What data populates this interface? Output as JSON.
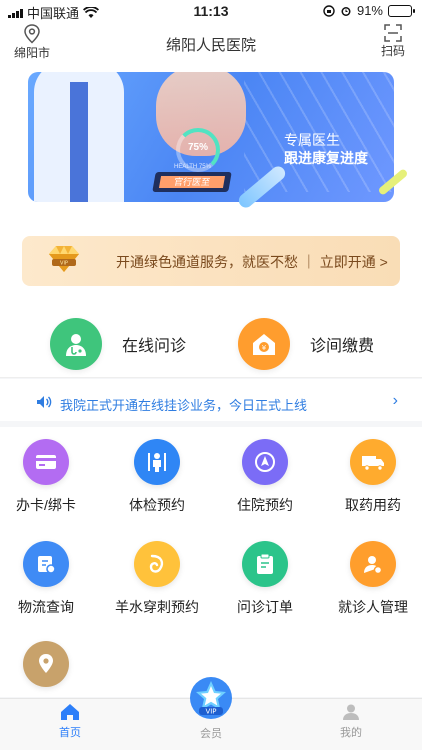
{
  "status_bar": {
    "carrier": "中国联通",
    "time": "11:13",
    "battery": "91%"
  },
  "header": {
    "location": "绵阳市",
    "title": "绵阳人民医院",
    "scan": "扫码"
  },
  "banner": {
    "line1": "专属医生",
    "line2": "跟进康复进度",
    "gauge": "75%",
    "health": "HEALTH 75%",
    "tablet": "官行医至"
  },
  "promo": {
    "text": "开通绿色通道服务，就医不愁 ｜ 立即开通 >"
  },
  "quick_actions": [
    {
      "label": "在线问诊",
      "icon": "doctor-icon",
      "color": "#3fc57c"
    },
    {
      "label": "诊间缴费",
      "icon": "payment-icon",
      "color": "#ff9d2e"
    }
  ],
  "notice": {
    "text": "我院正式开通在线挂诊业务，今日正式上线"
  },
  "grid_items": [
    {
      "label": "办卡/绑卡",
      "icon": "card-icon",
      "color": "#b36cf2"
    },
    {
      "label": "体检预约",
      "icon": "checkup-icon",
      "color": "#2f86f5"
    },
    {
      "label": "住院预约",
      "icon": "hospital-icon",
      "color": "#7b6cf6"
    },
    {
      "label": "取药用药",
      "icon": "delivery-icon",
      "color": "#ffab2e"
    },
    {
      "label": "物流查询",
      "icon": "logistics-icon",
      "color": "#3f8bf5"
    },
    {
      "label": "羊水穿刺预约",
      "icon": "prenatal-icon",
      "color": "#ffc23b"
    },
    {
      "label": "问诊订单",
      "icon": "order-icon",
      "color": "#2bc48a"
    },
    {
      "label": "就诊人管理",
      "icon": "patient-manage-icon",
      "color": "#ff9e2c"
    },
    {
      "label": "",
      "icon": "map-pin-icon",
      "color": "#c8a26b"
    }
  ],
  "tabbar": {
    "home": "首页",
    "member": "会员",
    "mine": "我的",
    "vip_badge": "VIP"
  }
}
